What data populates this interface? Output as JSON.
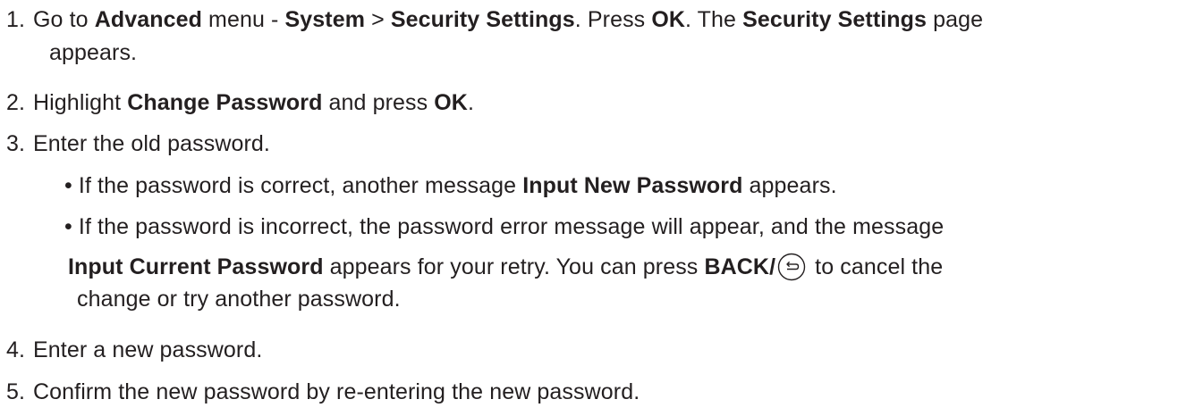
{
  "steps": [
    {
      "number": "1.",
      "line1": {
        "t1": "Go to ",
        "b1": "Advanced",
        "t2": " menu - ",
        "b2": "System",
        "t3": " > ",
        "b3": "Security Settings",
        "t4": ". Press ",
        "b4": "OK",
        "t5": ". The ",
        "b5": "Security Settings",
        "t6": " page"
      },
      "line2": "appears."
    },
    {
      "number": "2.",
      "t1": "Highlight ",
      "b1": "Change Password",
      "t2": " and press ",
      "b2": "OK",
      "t3": "."
    },
    {
      "number": "3.",
      "text": "Enter the old password.",
      "bullets": [
        {
          "marker": "•",
          "t1": "If the password is correct, another message ",
          "b1": "Input New Password",
          "t2": " appears."
        },
        {
          "marker": "•",
          "line1": "If the password is incorrect, the password error message will appear, and the message",
          "line2": {
            "b1": "Input Current Password",
            "t1": " appears for your retry. You can press ",
            "b2": "BACK",
            "t2": "/",
            "icon": "back-arrow-icon",
            "t3": " to cancel the"
          },
          "line3": "change or try another password."
        }
      ]
    },
    {
      "number": "4.",
      "text": "Enter a new password."
    },
    {
      "number": "5.",
      "text": "Confirm the new password by re-entering the new password."
    }
  ],
  "colors": {
    "text": "#231f20"
  }
}
